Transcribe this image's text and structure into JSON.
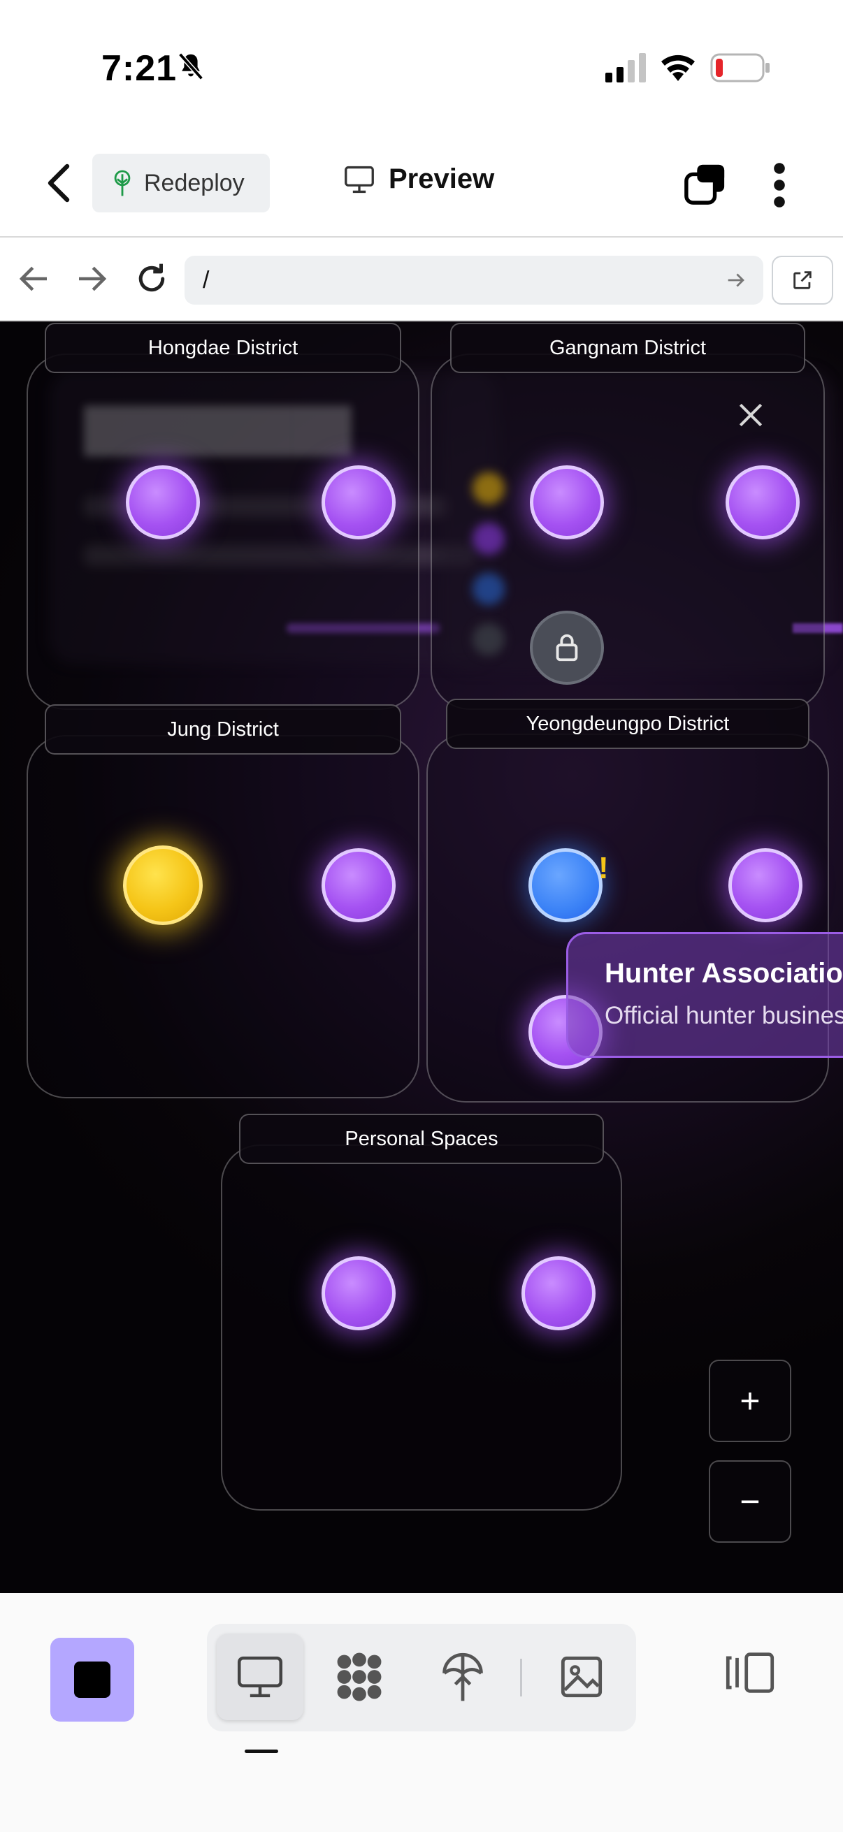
{
  "status_bar": {
    "time": "7:21"
  },
  "header": {
    "redeploy_label": "Redeploy",
    "preview_label": "Preview"
  },
  "url_bar": {
    "url": "/"
  },
  "map": {
    "districts": [
      {
        "name": "Hongdae District"
      },
      {
        "name": "Gangnam District"
      },
      {
        "name": "Jung District"
      },
      {
        "name": "Yeongdeungpo District"
      },
      {
        "name": "Personal Spaces"
      }
    ],
    "tooltip": {
      "title": "Hunter Association",
      "subtitle": "Official hunter business"
    },
    "alert": "!",
    "zoom_in": "+",
    "zoom_out": "−"
  },
  "colors": {
    "accent": "#a855f7",
    "gold": "#f5c518",
    "blue": "#3b82f6",
    "stop": "#b4a7ff"
  }
}
